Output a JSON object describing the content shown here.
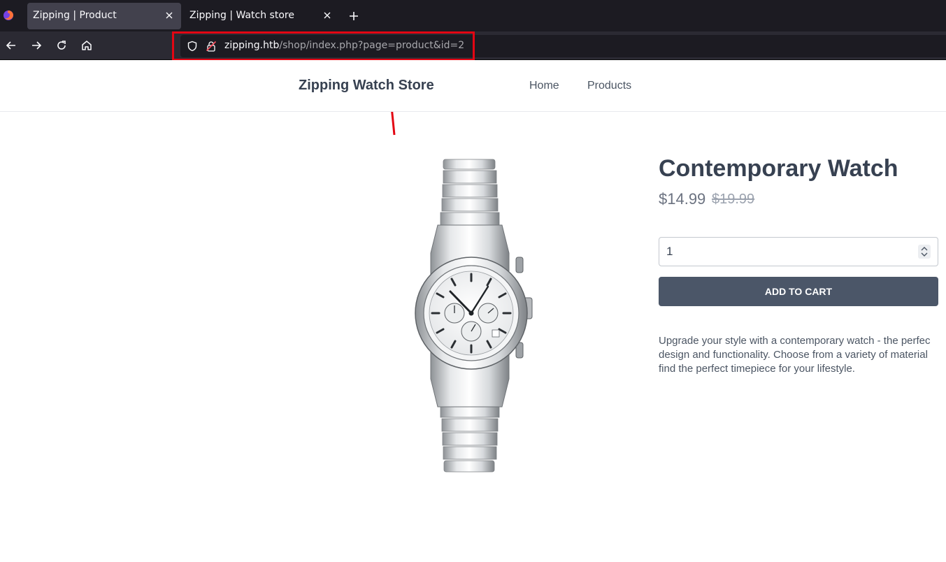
{
  "browser": {
    "tabs": [
      {
        "title": "Zipping | Product"
      },
      {
        "title": "Zipping | Watch store"
      }
    ],
    "url": {
      "host": "zipping.htb",
      "path": "/shop/index.php?page=product&id=2"
    }
  },
  "annotation": {
    "color": "#e30613"
  },
  "header": {
    "brand": "Zipping Watch Store",
    "nav": [
      "Home",
      "Products"
    ]
  },
  "product": {
    "title": "Contemporary Watch",
    "price": "$14.99",
    "original_price": "$19.99",
    "quantity": "1",
    "add_to_cart_label": "ADD TO CART",
    "description_lines": [
      "Upgrade your style with a contemporary watch - the perfec",
      "design and functionality. Choose from a variety of material",
      "find the perfect timepiece for your lifestyle."
    ]
  },
  "colors": {
    "button_bg": "#4b5668",
    "text_dark": "#374151",
    "chrome_dark": "#1c1b22"
  }
}
